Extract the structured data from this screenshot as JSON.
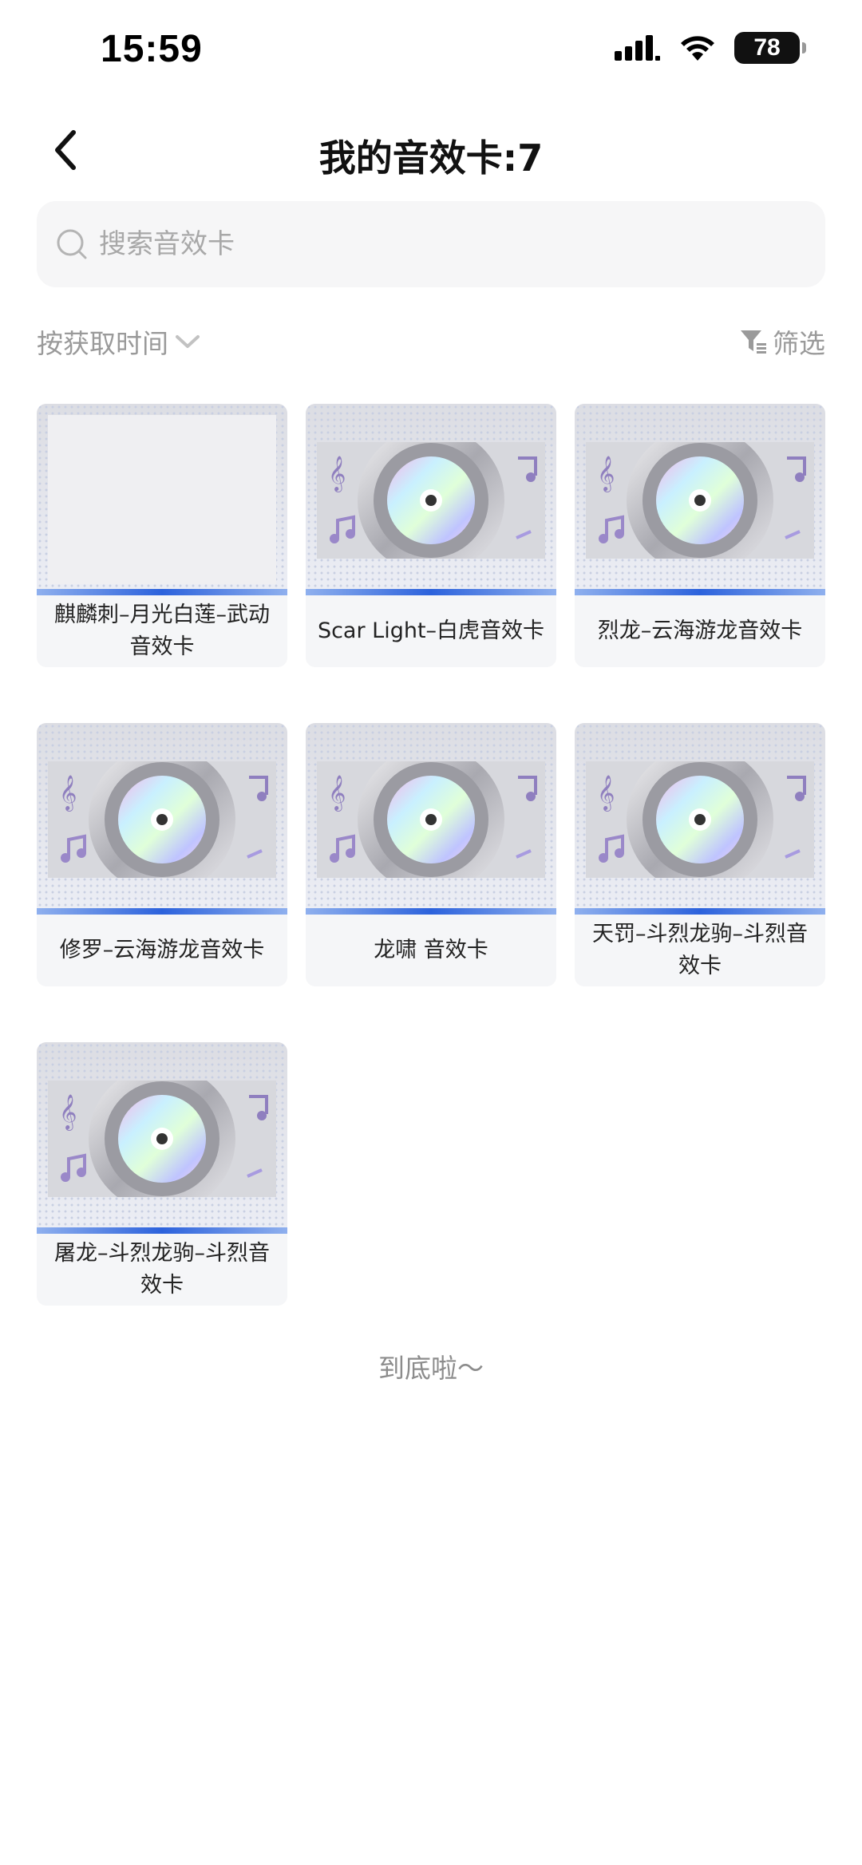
{
  "status_bar": {
    "time": "15:59",
    "battery": "78"
  },
  "header": {
    "title": "我的音效卡:7"
  },
  "search": {
    "placeholder": "搜索音效卡"
  },
  "sort": {
    "label": "按获取时间"
  },
  "filter": {
    "label": "筛选"
  },
  "cards": [
    {
      "label": "麒麟刺–月光白莲–武动音效卡",
      "has_image": false
    },
    {
      "label": "Scar Light–白虎音效卡",
      "has_image": true
    },
    {
      "label": "烈龙–云海游龙音效卡",
      "has_image": true
    },
    {
      "label": "修罗–云海游龙音效卡",
      "has_image": true
    },
    {
      "label": "龙啸 音效卡",
      "has_image": true
    },
    {
      "label": "天罚–斗烈龙驹–斗烈音效卡",
      "has_image": true
    },
    {
      "label": "屠龙–斗烈龙驹–斗烈音效卡",
      "has_image": true
    }
  ],
  "end_text": "到底啦～",
  "colors": {
    "accent_blue": "#2c62dc",
    "muted_text": "#9a9a9a",
    "search_bg": "#f6f6f7"
  }
}
